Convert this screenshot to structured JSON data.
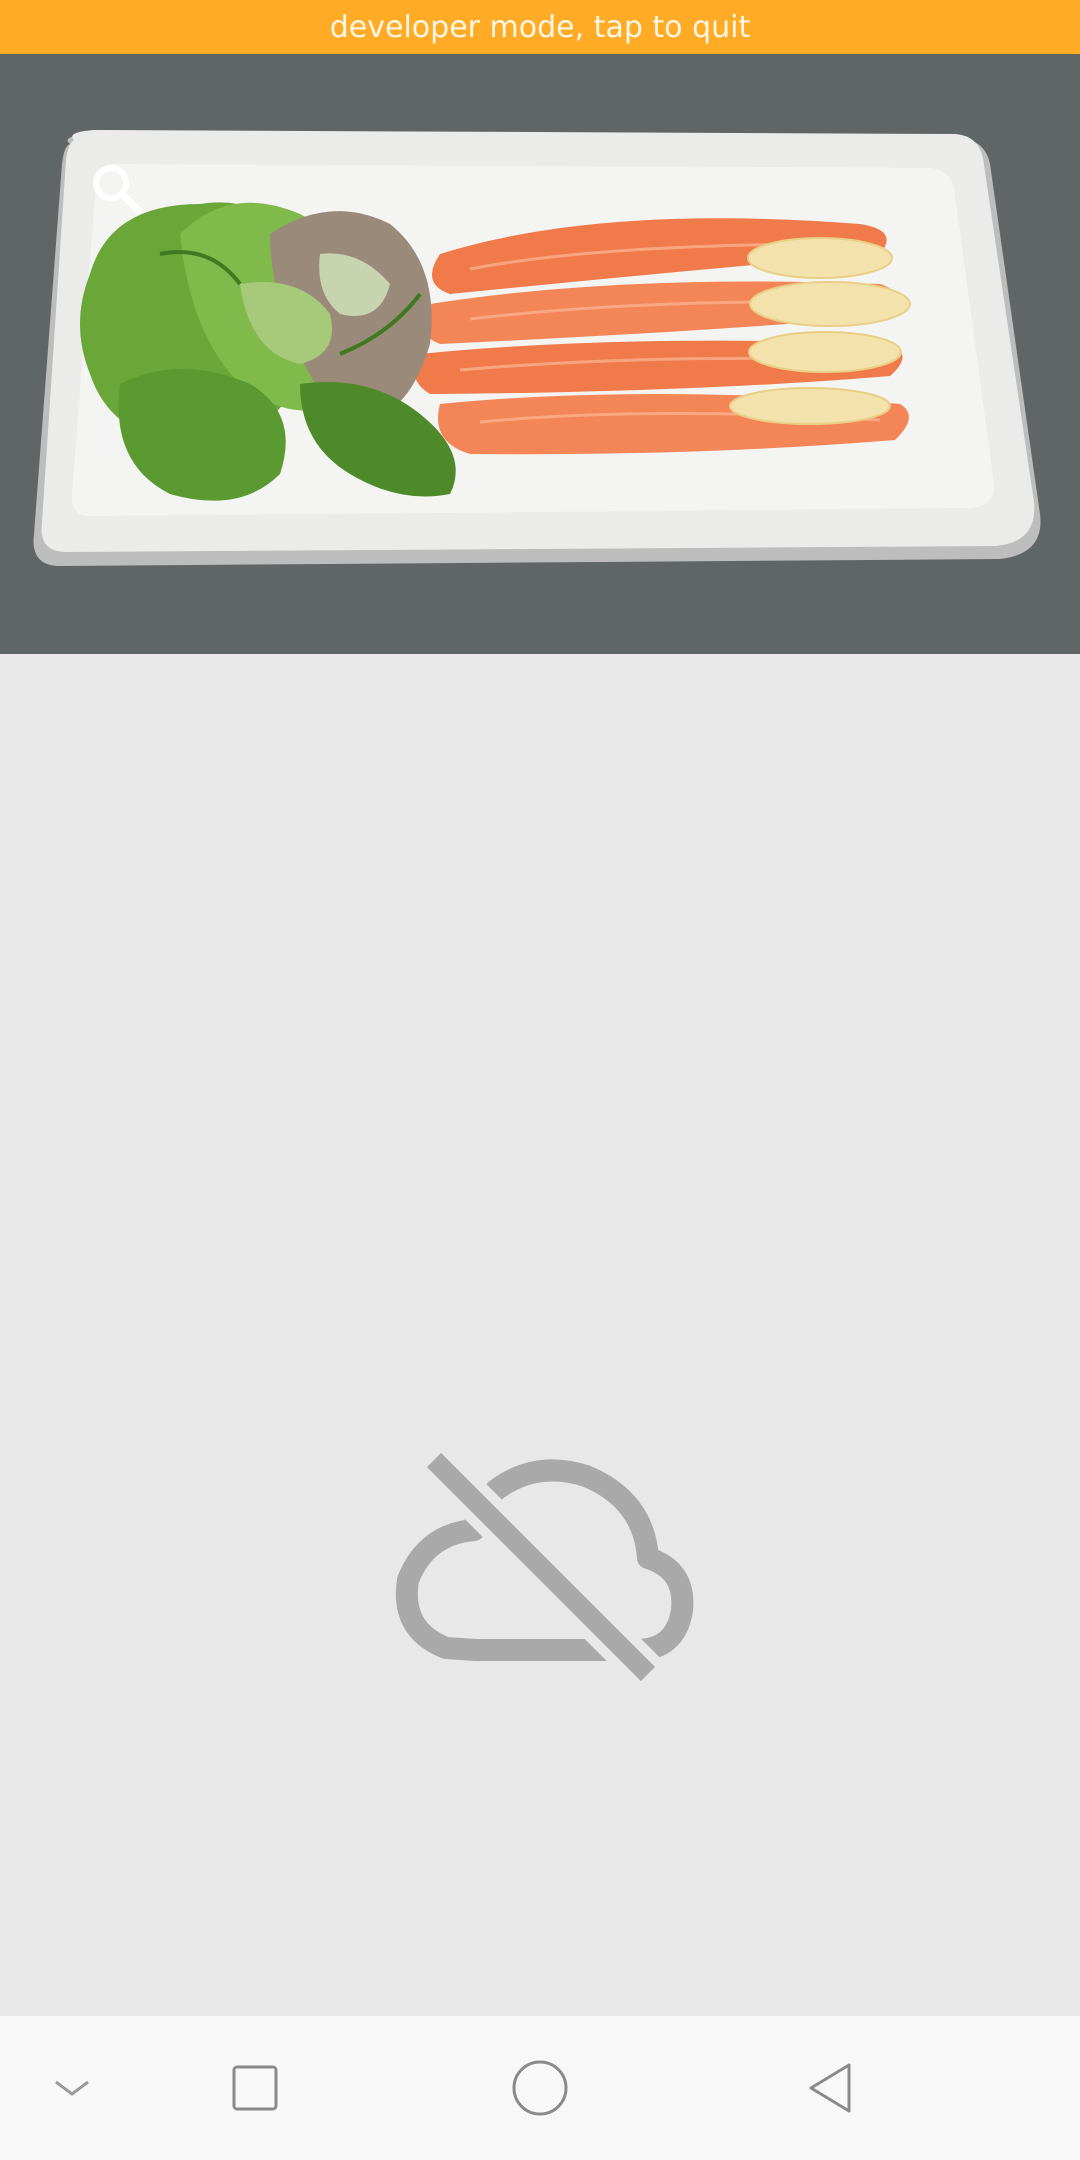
{
  "banner": {
    "text": "developer mode, tap to quit"
  },
  "hero": {
    "image": "salmon-carpaccio-with-salad-photo"
  },
  "header": {
    "search_icon": "search-icon"
  },
  "content": {
    "state_icon": "cloud-off-icon"
  },
  "navbar": {
    "items": [
      {
        "icon": "chevron-down-icon"
      },
      {
        "icon": "square-recents-icon"
      },
      {
        "icon": "circle-home-icon"
      },
      {
        "icon": "triangle-back-icon"
      }
    ]
  },
  "colors": {
    "banner_bg": "#ffab25",
    "hero_bg": "#606565",
    "content_bg": "#e8e8e8",
    "icon_gray": "#a9a9a9",
    "navbar_bg": "#f8f8f8"
  }
}
